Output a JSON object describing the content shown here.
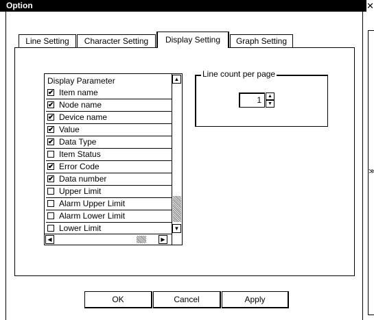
{
  "window": {
    "title": "Option",
    "close_glyph": "✕"
  },
  "tabs": [
    {
      "label": "Line Setting",
      "active": false
    },
    {
      "label": "Character Setting",
      "active": false
    },
    {
      "label": "Display Setting",
      "active": true
    },
    {
      "label": "Graph Setting",
      "active": false
    }
  ],
  "display_parameter": {
    "header": "Display Parameter",
    "items": [
      {
        "label": "Item name",
        "checked": true
      },
      {
        "label": "Node name",
        "checked": true
      },
      {
        "label": "Device name",
        "checked": true
      },
      {
        "label": "Value",
        "checked": true
      },
      {
        "label": "Data Type",
        "checked": true
      },
      {
        "label": "Item Status",
        "checked": false
      },
      {
        "label": "Error Code",
        "checked": true
      },
      {
        "label": "Data number",
        "checked": true
      },
      {
        "label": "Upper Limit",
        "checked": false
      },
      {
        "label": "Alarm Upper Limit",
        "checked": false
      },
      {
        "label": "Alarm Lower Limit",
        "checked": false
      },
      {
        "label": "Lower Limit",
        "checked": false
      }
    ]
  },
  "line_count": {
    "title": "Line count per page",
    "value": "1"
  },
  "buttons": {
    "ok": "OK",
    "cancel": "Cancel",
    "apply": "Apply"
  },
  "icons": {
    "check": "✔",
    "up": "▲",
    "down": "▼",
    "left": "◀",
    "right": "▶",
    "side": "≫"
  }
}
